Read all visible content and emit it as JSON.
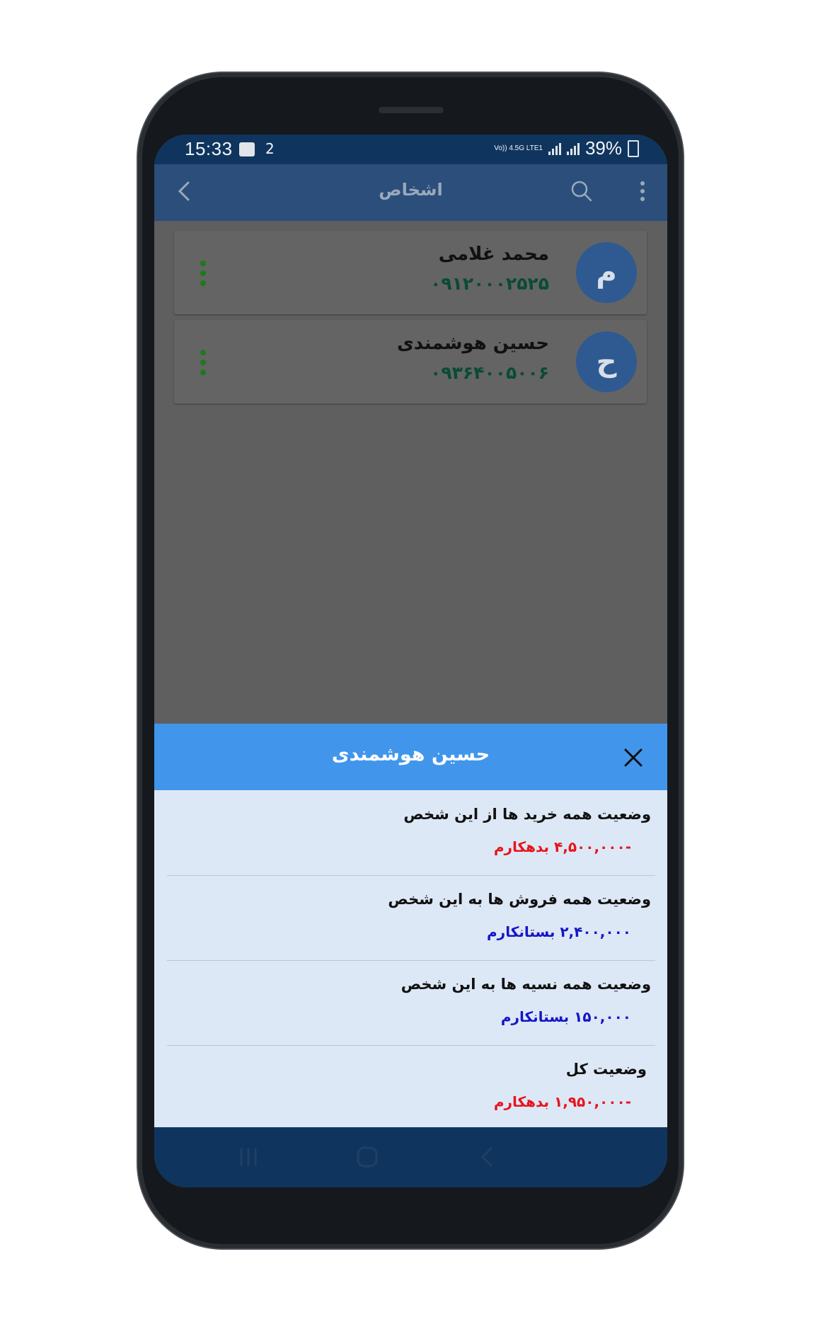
{
  "status_bar": {
    "time": "15:33",
    "notification_count": "2",
    "network_label": "Vo)) 4.5G LTE1",
    "battery": "39%"
  },
  "app_bar": {
    "title": "اشخاص"
  },
  "contacts": [
    {
      "avatar_letter": "م",
      "name": "محمد  غلامی",
      "phone": "۰۹۱۲۰۰۰۲۵۲۵"
    },
    {
      "avatar_letter": "ح",
      "name": "حسین   هوشمندی",
      "phone": "۰۹۳۶۴۰۰۵۰۰۶"
    }
  ],
  "sheet": {
    "title": "حسین  هوشمندی",
    "rows": [
      {
        "label": "وضعیت همه خرید ها از این شخص",
        "value": "-۴,۵۰۰,۰۰۰  بدهکارم",
        "status": "debtor"
      },
      {
        "label": "وضعیت همه فروش ها به این شخص",
        "value": "۲,۴۰۰,۰۰۰  بستانکارم",
        "status": "creditor"
      },
      {
        "label": "وضعیت همه نسیه ها به این شخص",
        "value": "۱۵۰,۰۰۰  بستانکارم",
        "status": "creditor"
      },
      {
        "label": "وضعیت کل",
        "value": "-۱,۹۵۰,۰۰۰  بدهکارم",
        "status": "debtor"
      }
    ]
  },
  "colors": {
    "debtor": "#e8141c",
    "creditor": "#1515c8",
    "accent": "#4196ec",
    "app_bar": "#2b4f7a",
    "avatar": "#2e5a91"
  }
}
